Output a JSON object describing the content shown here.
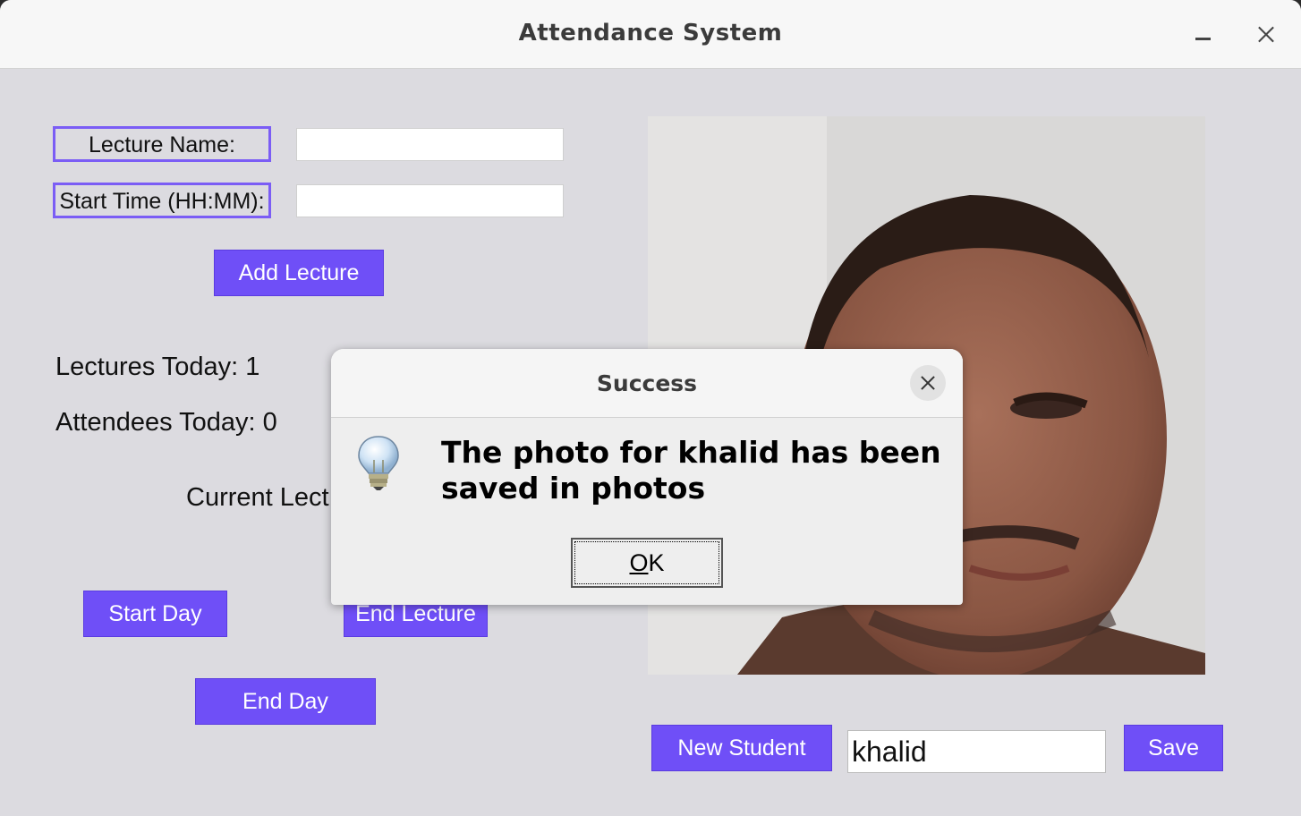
{
  "window": {
    "title": "Attendance System"
  },
  "form": {
    "lecture_name_label": "Lecture Name:",
    "lecture_name_value": "",
    "start_time_label": "Start Time (HH:MM):",
    "start_time_value": "",
    "add_lecture_label": "Add Lecture"
  },
  "stats": {
    "lectures_today": "Lectures Today: 1",
    "attendees_today": "Attendees Today: 0",
    "current_lecture_partial": "Current Lect"
  },
  "controls": {
    "start_day_label": "Start Day",
    "end_lecture_label": "End Lecture",
    "end_day_label": "End Day",
    "new_student_label": "New Student",
    "student_name_value": "khalid",
    "save_label": "Save"
  },
  "dialog": {
    "title": "Success",
    "message": "The photo for khalid has been saved in photos",
    "ok_mnemonic": "O",
    "ok_rest": "K",
    "icon": "lightbulb-icon"
  },
  "colors": {
    "accent": "#6f4ff7",
    "window_bg": "#dcdbe0",
    "titlebar_bg": "#f7f7f7"
  }
}
